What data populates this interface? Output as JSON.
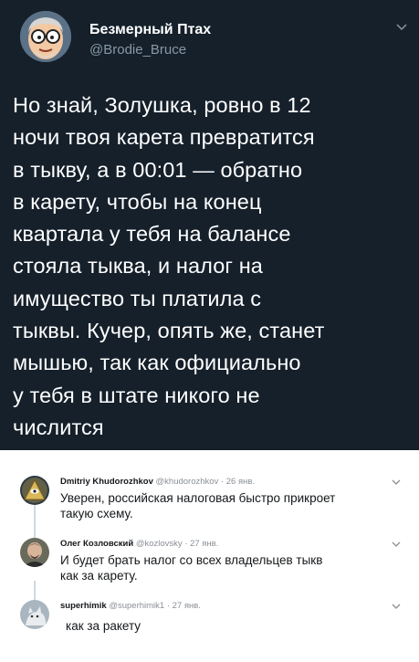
{
  "tweet": {
    "author_name": "Безмерный Птах",
    "author_handle": "@Brodie_Bruce",
    "text_lines": [
      "Но знай, Золушка, ровно в 12",
      "ночи твоя карета превратится",
      "в тыкву, а в 00:01 — обратно",
      "в карету, чтобы на конец",
      "квартала у тебя на балансе",
      "стояла тыква, и налог на",
      "имущество ты платила с",
      "тыквы. Кучер, опять же, станет",
      "мышью, так как официально",
      "у тебя в штате никого не",
      "числится"
    ],
    "menu_icon": "chevron-down-icon",
    "bg_color": "#15202b"
  },
  "replies": [
    {
      "name": "Dmitriy Khudorozhkov",
      "handle": "@khudorozhkov",
      "date": "· 26 янв.",
      "text_lines": [
        "Уверен, российская налоговая быстро прикроет",
        "такую схему."
      ],
      "avatar_icon": "pyramid-eye-avatar"
    },
    {
      "name": "Олег Козловский",
      "handle": "@kozlovsky",
      "date": "· 27 янв.",
      "text_lines": [
        "И будет брать налог со всех владельцев тыкв",
        "как за карету."
      ],
      "avatar_icon": "person-photo-avatar"
    },
    {
      "name": "superhimik",
      "handle": "@superhimik1",
      "date": "· 27 янв.",
      "text_lines": [
        "как за ракету"
      ],
      "avatar_icon": "cat-photo-avatar"
    }
  ]
}
